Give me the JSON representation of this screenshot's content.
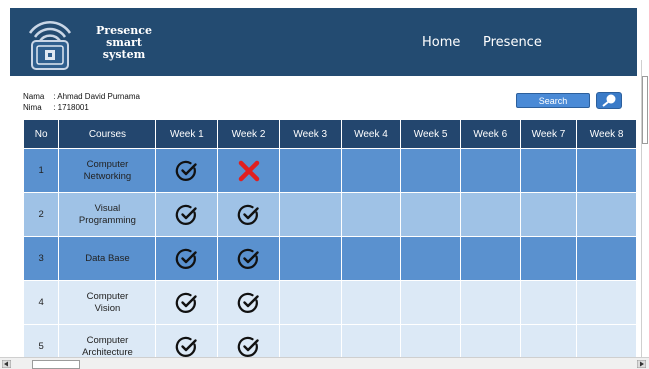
{
  "header": {
    "brand_line1": "Presence smart",
    "brand_line2": "system",
    "nav": {
      "home": "Home",
      "presence": "Presence"
    }
  },
  "student": {
    "name_label": "Nama",
    "name_value": ": Ahmad David Purnama",
    "id_label": "Nima",
    "id_value": ": 1718001"
  },
  "search": {
    "button_label": "Search",
    "icon": "magnifier-icon"
  },
  "table": {
    "headers": [
      "No",
      "Courses",
      "Week 1",
      "Week 2",
      "Week 3",
      "Week 4",
      "Week 5",
      "Week 6",
      "Week 7",
      "Week 8"
    ],
    "rows": [
      {
        "no": "1",
        "course": "Computer Networking",
        "weeks": [
          "present",
          "absent",
          "",
          "",
          "",
          "",
          "",
          ""
        ]
      },
      {
        "no": "2",
        "course": "Visual Programming",
        "weeks": [
          "present",
          "present",
          "",
          "",
          "",
          "",
          "",
          ""
        ]
      },
      {
        "no": "3",
        "course": "Data Base",
        "weeks": [
          "present",
          "present",
          "",
          "",
          "",
          "",
          "",
          ""
        ]
      },
      {
        "no": "4",
        "course": "Computer Vision",
        "weeks": [
          "present",
          "present",
          "",
          "",
          "",
          "",
          "",
          ""
        ]
      },
      {
        "no": "5",
        "course": "Computer Architecture",
        "weeks": [
          "present",
          "present",
          "",
          "",
          "",
          "",
          "",
          ""
        ]
      }
    ]
  },
  "colors": {
    "header_bg": "#234b71",
    "table_header_bg": "#23466e",
    "row_dark": "#5a91cf",
    "row_mid": "#9fc2e6",
    "row_light": "#dce9f6",
    "absent_mark": "#e01f1f"
  }
}
